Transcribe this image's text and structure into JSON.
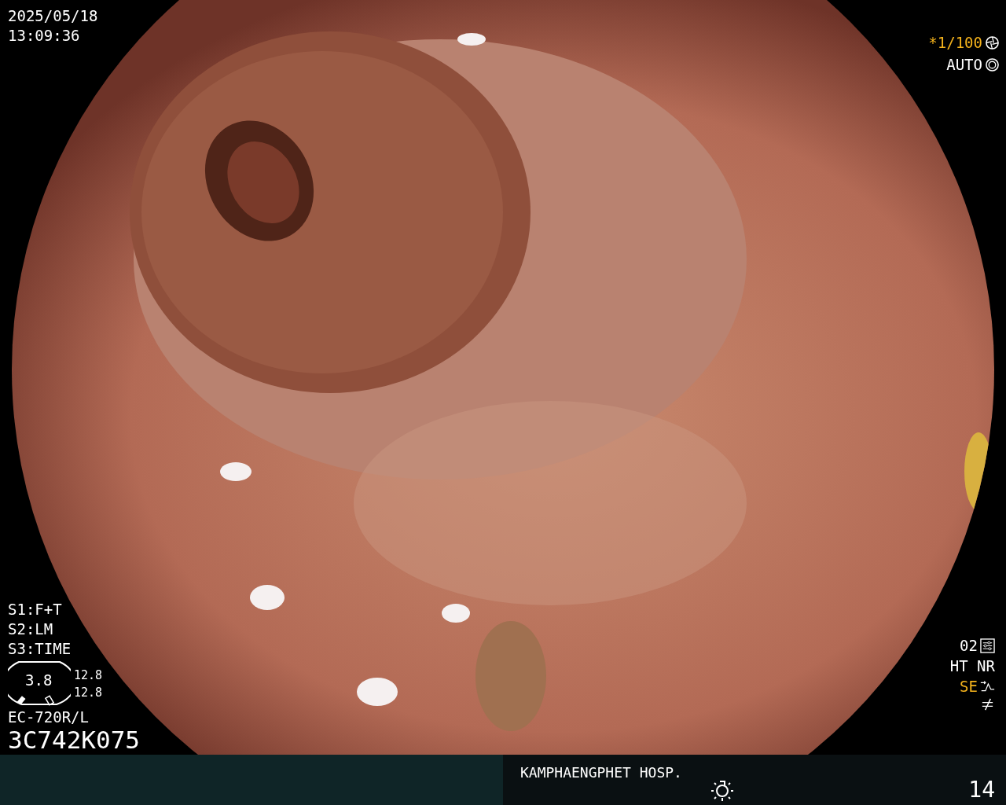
{
  "header": {
    "date": "2025/05/18",
    "time": "13:09:36"
  },
  "shutter": {
    "speed": "*1/100",
    "mode": "AUTO"
  },
  "switches": [
    "S1:F+T",
    "S2:LM",
    "S3:TIME"
  ],
  "scope": {
    "gauge": "3.8",
    "readings": [
      "12.8",
      "12.8"
    ],
    "model": "EC-720R/L",
    "serial": "3C742K075"
  },
  "settings": {
    "preset": "02",
    "modes": "HT NR",
    "enhance": "SE"
  },
  "footer": {
    "hospital": "KAMPHAENGPHET HOSP.",
    "count": "14"
  }
}
